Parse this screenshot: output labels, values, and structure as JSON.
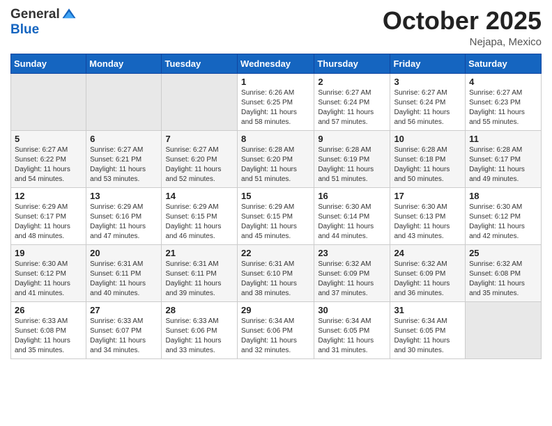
{
  "header": {
    "logo_general": "General",
    "logo_blue": "Blue",
    "month": "October 2025",
    "location": "Nejapa, Mexico"
  },
  "weekdays": [
    "Sunday",
    "Monday",
    "Tuesday",
    "Wednesday",
    "Thursday",
    "Friday",
    "Saturday"
  ],
  "weeks": [
    [
      {
        "day": "",
        "empty": true
      },
      {
        "day": "",
        "empty": true
      },
      {
        "day": "",
        "empty": true
      },
      {
        "day": "1",
        "sunrise": "6:26 AM",
        "sunset": "6:25 PM",
        "daylight": "11 hours and 58 minutes."
      },
      {
        "day": "2",
        "sunrise": "6:27 AM",
        "sunset": "6:24 PM",
        "daylight": "11 hours and 57 minutes."
      },
      {
        "day": "3",
        "sunrise": "6:27 AM",
        "sunset": "6:24 PM",
        "daylight": "11 hours and 56 minutes."
      },
      {
        "day": "4",
        "sunrise": "6:27 AM",
        "sunset": "6:23 PM",
        "daylight": "11 hours and 55 minutes."
      }
    ],
    [
      {
        "day": "5",
        "sunrise": "6:27 AM",
        "sunset": "6:22 PM",
        "daylight": "11 hours and 54 minutes."
      },
      {
        "day": "6",
        "sunrise": "6:27 AM",
        "sunset": "6:21 PM",
        "daylight": "11 hours and 53 minutes."
      },
      {
        "day": "7",
        "sunrise": "6:27 AM",
        "sunset": "6:20 PM",
        "daylight": "11 hours and 52 minutes."
      },
      {
        "day": "8",
        "sunrise": "6:28 AM",
        "sunset": "6:20 PM",
        "daylight": "11 hours and 51 minutes."
      },
      {
        "day": "9",
        "sunrise": "6:28 AM",
        "sunset": "6:19 PM",
        "daylight": "11 hours and 51 minutes."
      },
      {
        "day": "10",
        "sunrise": "6:28 AM",
        "sunset": "6:18 PM",
        "daylight": "11 hours and 50 minutes."
      },
      {
        "day": "11",
        "sunrise": "6:28 AM",
        "sunset": "6:17 PM",
        "daylight": "11 hours and 49 minutes."
      }
    ],
    [
      {
        "day": "12",
        "sunrise": "6:29 AM",
        "sunset": "6:17 PM",
        "daylight": "11 hours and 48 minutes."
      },
      {
        "day": "13",
        "sunrise": "6:29 AM",
        "sunset": "6:16 PM",
        "daylight": "11 hours and 47 minutes."
      },
      {
        "day": "14",
        "sunrise": "6:29 AM",
        "sunset": "6:15 PM",
        "daylight": "11 hours and 46 minutes."
      },
      {
        "day": "15",
        "sunrise": "6:29 AM",
        "sunset": "6:15 PM",
        "daylight": "11 hours and 45 minutes."
      },
      {
        "day": "16",
        "sunrise": "6:30 AM",
        "sunset": "6:14 PM",
        "daylight": "11 hours and 44 minutes."
      },
      {
        "day": "17",
        "sunrise": "6:30 AM",
        "sunset": "6:13 PM",
        "daylight": "11 hours and 43 minutes."
      },
      {
        "day": "18",
        "sunrise": "6:30 AM",
        "sunset": "6:12 PM",
        "daylight": "11 hours and 42 minutes."
      }
    ],
    [
      {
        "day": "19",
        "sunrise": "6:30 AM",
        "sunset": "6:12 PM",
        "daylight": "11 hours and 41 minutes."
      },
      {
        "day": "20",
        "sunrise": "6:31 AM",
        "sunset": "6:11 PM",
        "daylight": "11 hours and 40 minutes."
      },
      {
        "day": "21",
        "sunrise": "6:31 AM",
        "sunset": "6:11 PM",
        "daylight": "11 hours and 39 minutes."
      },
      {
        "day": "22",
        "sunrise": "6:31 AM",
        "sunset": "6:10 PM",
        "daylight": "11 hours and 38 minutes."
      },
      {
        "day": "23",
        "sunrise": "6:32 AM",
        "sunset": "6:09 PM",
        "daylight": "11 hours and 37 minutes."
      },
      {
        "day": "24",
        "sunrise": "6:32 AM",
        "sunset": "6:09 PM",
        "daylight": "11 hours and 36 minutes."
      },
      {
        "day": "25",
        "sunrise": "6:32 AM",
        "sunset": "6:08 PM",
        "daylight": "11 hours and 35 minutes."
      }
    ],
    [
      {
        "day": "26",
        "sunrise": "6:33 AM",
        "sunset": "6:08 PM",
        "daylight": "11 hours and 35 minutes."
      },
      {
        "day": "27",
        "sunrise": "6:33 AM",
        "sunset": "6:07 PM",
        "daylight": "11 hours and 34 minutes."
      },
      {
        "day": "28",
        "sunrise": "6:33 AM",
        "sunset": "6:06 PM",
        "daylight": "11 hours and 33 minutes."
      },
      {
        "day": "29",
        "sunrise": "6:34 AM",
        "sunset": "6:06 PM",
        "daylight": "11 hours and 32 minutes."
      },
      {
        "day": "30",
        "sunrise": "6:34 AM",
        "sunset": "6:05 PM",
        "daylight": "11 hours and 31 minutes."
      },
      {
        "day": "31",
        "sunrise": "6:34 AM",
        "sunset": "6:05 PM",
        "daylight": "11 hours and 30 minutes."
      },
      {
        "day": "",
        "empty": true
      }
    ]
  ],
  "labels": {
    "sunrise": "Sunrise:",
    "sunset": "Sunset:",
    "daylight": "Daylight:"
  }
}
